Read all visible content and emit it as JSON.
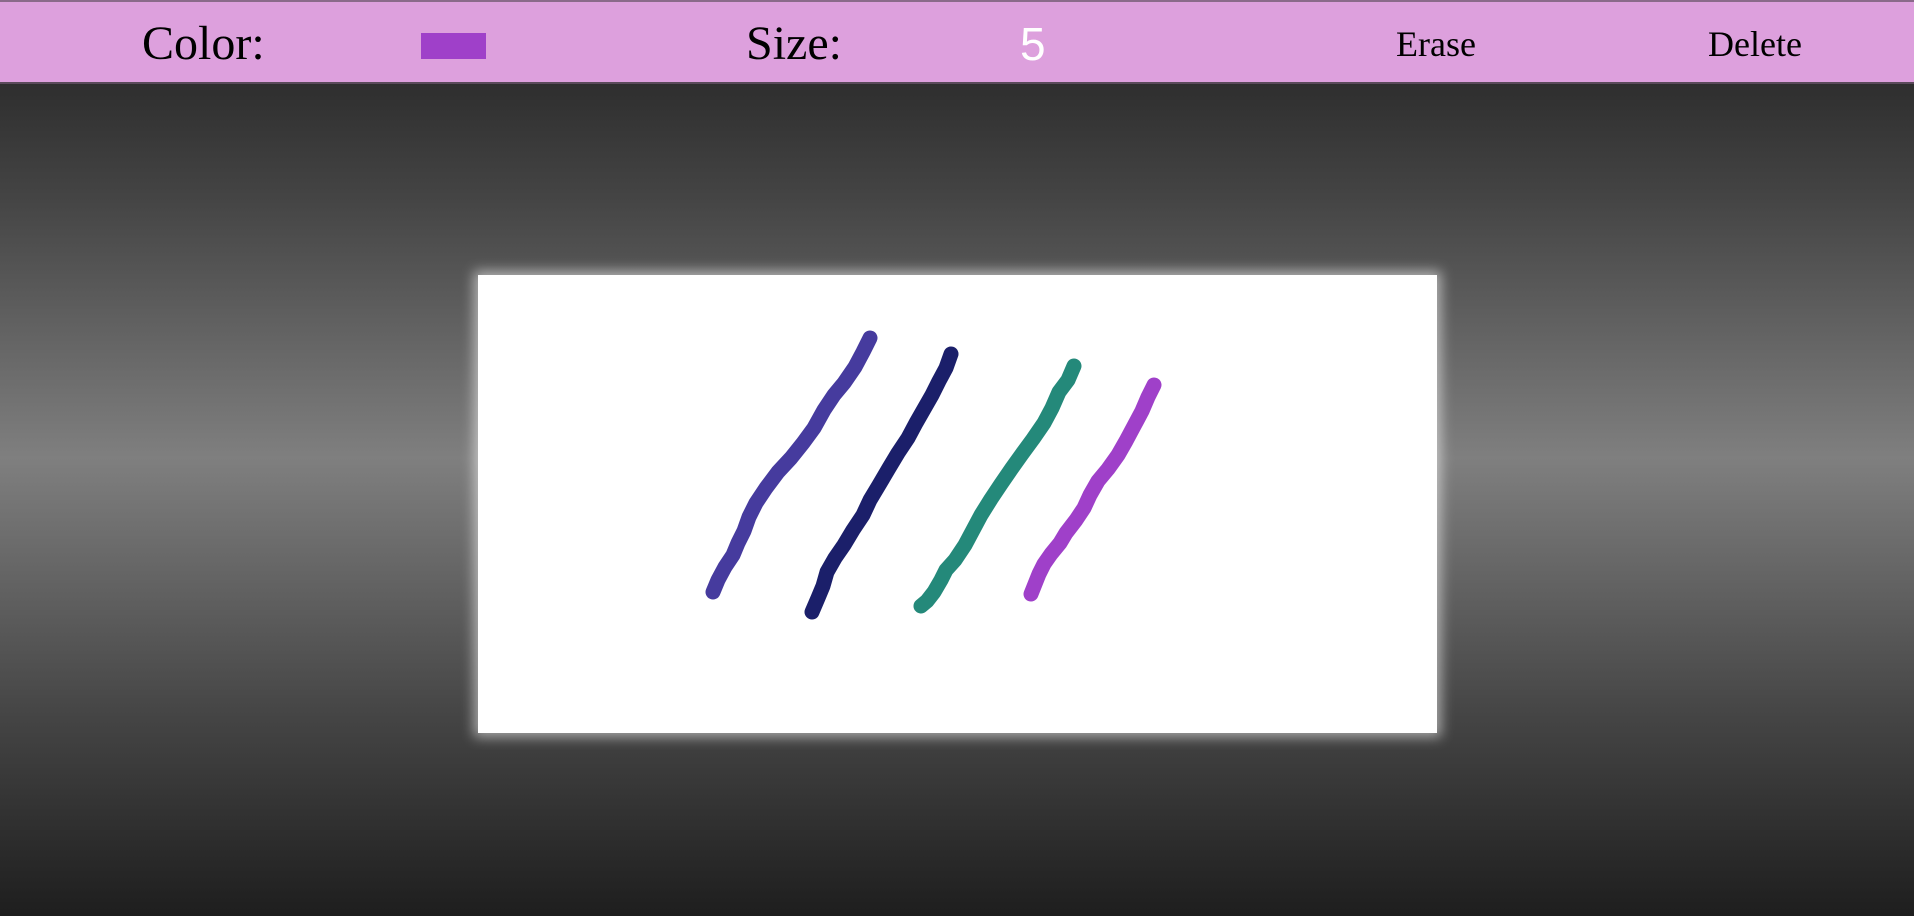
{
  "toolbar": {
    "color_label": "Color:",
    "color_value": "#9f40c9",
    "size_label": "Size:",
    "size_value": "5",
    "erase_label": "Erase",
    "delete_label": "Delete"
  },
  "canvas": {
    "background": "#ffffff",
    "strokes": [
      {
        "color": "#463b9e"
      },
      {
        "color": "#1b1f6a"
      },
      {
        "color": "#24897a"
      },
      {
        "color": "#9f40c9"
      }
    ]
  }
}
